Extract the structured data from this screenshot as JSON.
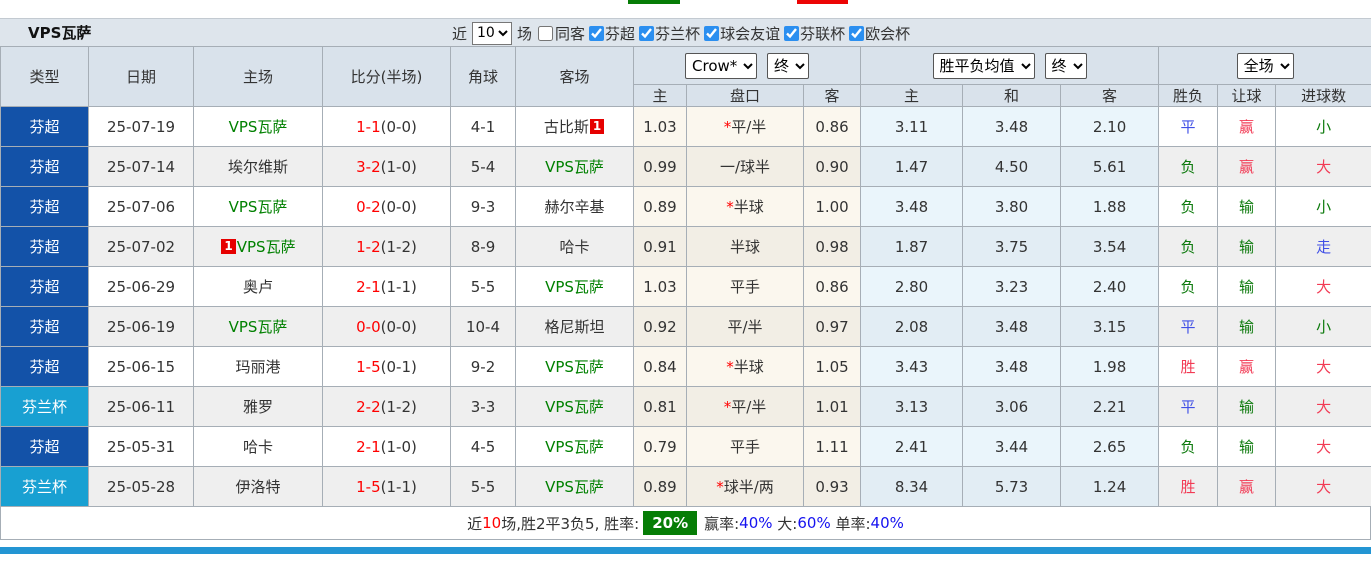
{
  "header": {
    "title": "VPS瓦萨",
    "recent_label": "近",
    "recent_value": "10",
    "games_label": "场",
    "same_away": {
      "label": "同客",
      "checked": false
    },
    "leagues": [
      {
        "label": "芬超",
        "checked": true
      },
      {
        "label": "芬兰杯",
        "checked": true
      },
      {
        "label": "球会友谊",
        "checked": true
      },
      {
        "label": "芬联杯",
        "checked": true
      },
      {
        "label": "欧会杯",
        "checked": true
      }
    ]
  },
  "table": {
    "columns": [
      "类型",
      "日期",
      "主场",
      "比分(半场)",
      "角球",
      "客场"
    ],
    "dropdowns": {
      "company": "Crow*",
      "final1": "终",
      "avg": "胜平负均值",
      "final2": "终",
      "scope": "全场"
    },
    "subheaders": {
      "h_home": "主",
      "h_handicap": "盘口",
      "h_away": "客",
      "a_home": "主",
      "a_draw": "和",
      "a_away": "客",
      "r_result": "胜负",
      "r_handicap": "让球",
      "r_goals": "进球数"
    },
    "rows": [
      {
        "type": "芬超",
        "date": "25-07-19",
        "home": "VPS瓦萨",
        "score": "1-1",
        "half": "(0-0)",
        "corner": "4-1",
        "away": "古比斯",
        "away_badge_after": "1",
        "odds_home": "1.03",
        "handicap_star": "*",
        "handicap": "平/半",
        "odds_away": "0.86",
        "avg_home": "3.11",
        "avg_draw": "3.48",
        "avg_away": "2.10",
        "result": "平",
        "handicap_result": "赢",
        "goals": "小"
      },
      {
        "type": "芬超",
        "date": "25-07-14",
        "home": "埃尔维斯",
        "score": "3-2",
        "half": "(1-0)",
        "corner": "5-4",
        "away": "VPS瓦萨",
        "odds_home": "0.99",
        "handicap": "一/球半",
        "odds_away": "0.90",
        "avg_home": "1.47",
        "avg_draw": "4.50",
        "avg_away": "5.61",
        "result": "负",
        "handicap_result": "赢",
        "goals": "大"
      },
      {
        "type": "芬超",
        "date": "25-07-06",
        "home": "VPS瓦萨",
        "score": "0-2",
        "half": "(0-0)",
        "corner": "9-3",
        "away": "赫尔辛基",
        "odds_home": "0.89",
        "handicap_star": "*",
        "handicap": "半球",
        "odds_away": "1.00",
        "avg_home": "3.48",
        "avg_draw": "3.80",
        "avg_away": "1.88",
        "result": "负",
        "handicap_result": "输",
        "goals": "小"
      },
      {
        "type": "芬超",
        "date": "25-07-02",
        "home_badge_before": "1",
        "home": "VPS瓦萨",
        "score": "1-2",
        "half": "(1-2)",
        "corner": "8-9",
        "away": "哈卡",
        "odds_home": "0.91",
        "handicap": "半球",
        "odds_away": "0.98",
        "avg_home": "1.87",
        "avg_draw": "3.75",
        "avg_away": "3.54",
        "result": "负",
        "handicap_result": "输",
        "goals": "走"
      },
      {
        "type": "芬超",
        "date": "25-06-29",
        "home": "奥卢",
        "score": "2-1",
        "half": "(1-1)",
        "corner": "5-5",
        "away": "VPS瓦萨",
        "odds_home": "1.03",
        "handicap": "平手",
        "odds_away": "0.86",
        "avg_home": "2.80",
        "avg_draw": "3.23",
        "avg_away": "2.40",
        "result": "负",
        "handicap_result": "输",
        "goals": "大"
      },
      {
        "type": "芬超",
        "date": "25-06-19",
        "home": "VPS瓦萨",
        "score": "0-0",
        "half": "(0-0)",
        "corner": "10-4",
        "away": "格尼斯坦",
        "odds_home": "0.92",
        "handicap": "平/半",
        "odds_away": "0.97",
        "avg_home": "2.08",
        "avg_draw": "3.48",
        "avg_away": "3.15",
        "result": "平",
        "handicap_result": "输",
        "goals": "小"
      },
      {
        "type": "芬超",
        "date": "25-06-15",
        "home": "玛丽港",
        "score": "1-5",
        "half": "(0-1)",
        "corner": "9-2",
        "away": "VPS瓦萨",
        "odds_home": "0.84",
        "handicap_star": "*",
        "handicap": "半球",
        "odds_away": "1.05",
        "avg_home": "3.43",
        "avg_draw": "3.48",
        "avg_away": "1.98",
        "result": "胜",
        "handicap_result": "赢",
        "goals": "大"
      },
      {
        "type": "芬兰杯",
        "date": "25-06-11",
        "home": "雅罗",
        "score": "2-2",
        "half": "(1-2)",
        "corner": "3-3",
        "away": "VPS瓦萨",
        "odds_home": "0.81",
        "handicap_star": "*",
        "handicap": "平/半",
        "odds_away": "1.01",
        "avg_home": "3.13",
        "avg_draw": "3.06",
        "avg_away": "2.21",
        "result": "平",
        "handicap_result": "输",
        "goals": "大"
      },
      {
        "type": "芬超",
        "date": "25-05-31",
        "home": "哈卡",
        "score": "2-1",
        "half": "(1-0)",
        "corner": "4-5",
        "away": "VPS瓦萨",
        "odds_home": "0.79",
        "handicap": "平手",
        "odds_away": "1.11",
        "avg_home": "2.41",
        "avg_draw": "3.44",
        "avg_away": "2.65",
        "result": "负",
        "handicap_result": "输",
        "goals": "大"
      },
      {
        "type": "芬兰杯",
        "date": "25-05-28",
        "home": "伊洛特",
        "score": "1-5",
        "half": "(1-1)",
        "corner": "5-5",
        "away": "VPS瓦萨",
        "odds_home": "0.89",
        "handicap_star": "*",
        "handicap": "球半/两",
        "odds_away": "0.93",
        "avg_home": "8.34",
        "avg_draw": "5.73",
        "avg_away": "1.24",
        "result": "胜",
        "handicap_result": "赢",
        "goals": "大"
      }
    ]
  },
  "footer": {
    "recent_label": "近",
    "recent_count": "10",
    "summary": "场,胜2平3负5, 胜率:",
    "win_rate": "20%",
    "win_odds_label": "赢率:",
    "win_odds": "40%",
    "big_label": "大:",
    "big": "60%",
    "single_label": "单率:",
    "single": "40%"
  },
  "colors": {
    "league_type": "#1352a8",
    "cup_type": "#18a0d2",
    "self_team": "#008000",
    "score_red": "#ff0000",
    "result_red": "#f23b55",
    "result_green": "#0c7a0c",
    "result_blue": "#4150e6",
    "win_rate_badge": "#067d06",
    "bottom_bar": "#2395d3"
  }
}
